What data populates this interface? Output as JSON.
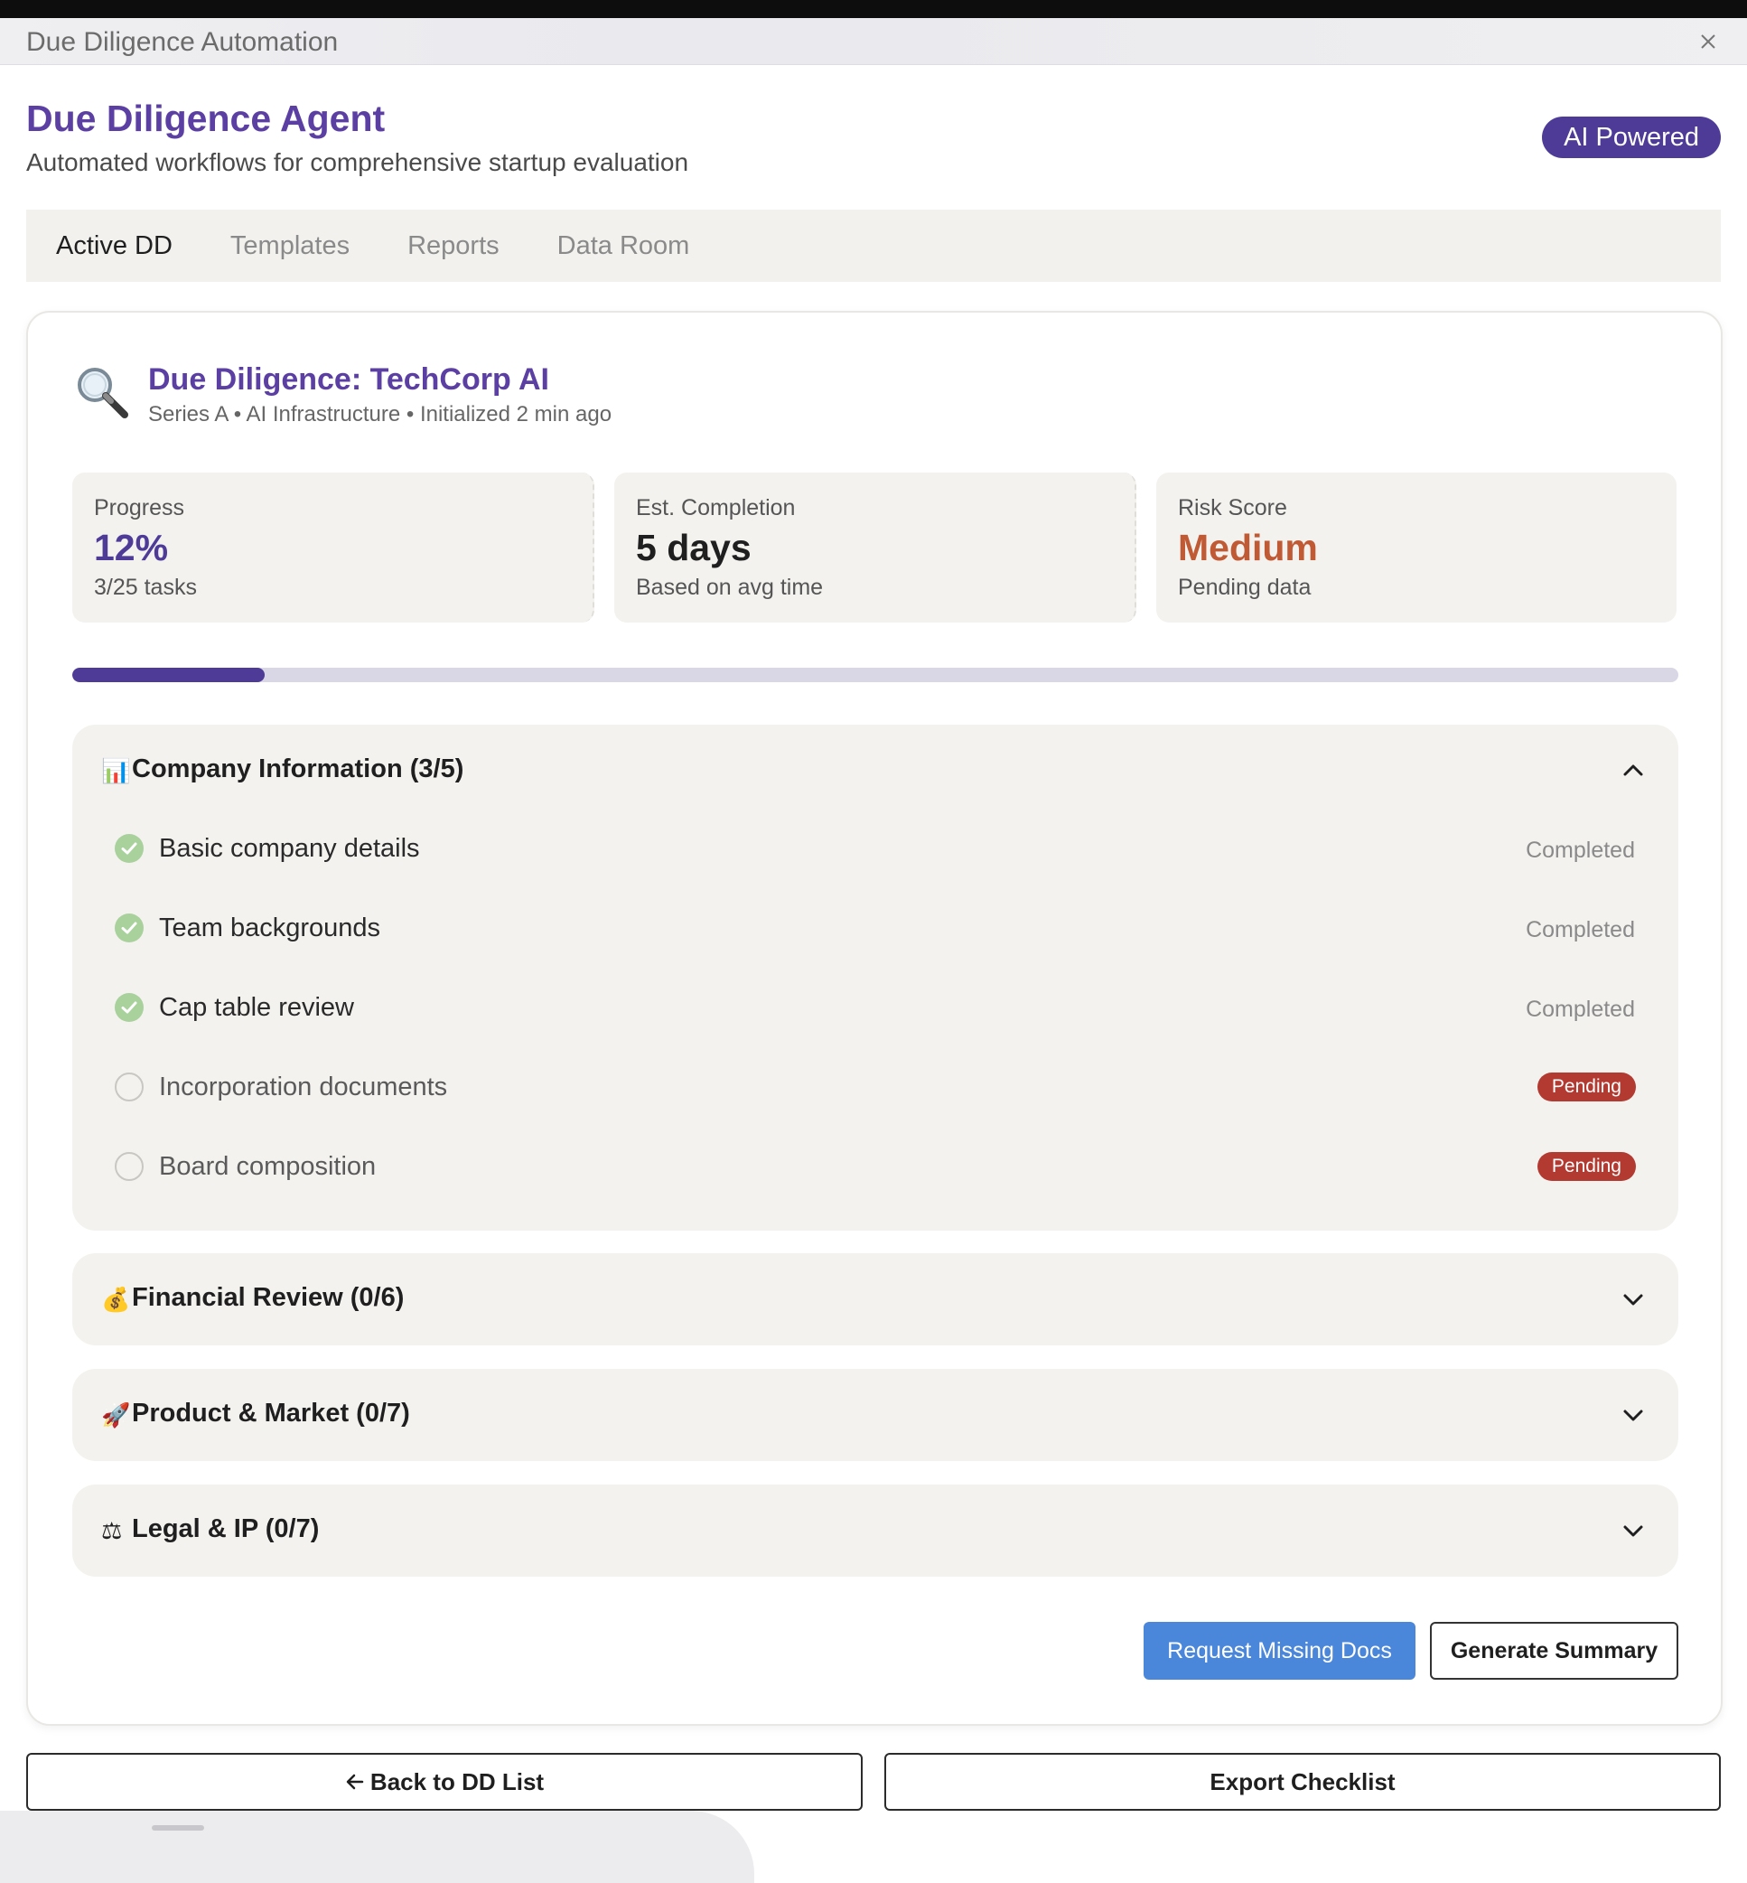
{
  "window": {
    "title": "Due Diligence Automation"
  },
  "header": {
    "title": "Due Diligence Agent",
    "subtitle": "Automated workflows for comprehensive startup evaluation",
    "badge": "AI Powered"
  },
  "tabs": [
    {
      "label": "Active DD",
      "active": true
    },
    {
      "label": "Templates",
      "active": false
    },
    {
      "label": "Reports",
      "active": false
    },
    {
      "label": "Data Room",
      "active": false
    }
  ],
  "dd": {
    "icon": "magnifying-glass-icon",
    "title": "Due Diligence: TechCorp AI",
    "meta": "Series A • AI Infrastructure • Initialized 2 min ago",
    "stats": [
      {
        "label": "Progress",
        "value": "12%",
        "sub": "3/25 tasks",
        "color": "#4e3b98"
      },
      {
        "label": "Est. Completion",
        "value": "5 days",
        "sub": "Based on avg time",
        "color": "#1f1f1f"
      },
      {
        "label": "Risk Score",
        "value": "Medium",
        "sub": "Pending data",
        "color": "#c05a35"
      }
    ],
    "progress_fraction": 0.12
  },
  "sections": [
    {
      "emoji": "📊",
      "icon": "bar-chart-icon",
      "title": "Company Information (3/5)",
      "expanded": true,
      "tasks": [
        {
          "label": "Basic company details",
          "status": "Completed",
          "done": true
        },
        {
          "label": "Team backgrounds",
          "status": "Completed",
          "done": true
        },
        {
          "label": "Cap table review",
          "status": "Completed",
          "done": true
        },
        {
          "label": "Incorporation documents",
          "status": "Pending",
          "done": false
        },
        {
          "label": "Board composition",
          "status": "Pending",
          "done": false
        }
      ]
    },
    {
      "emoji": "💰",
      "icon": "money-bag-icon",
      "title": "Financial Review (0/6)",
      "expanded": false
    },
    {
      "emoji": "🚀",
      "icon": "rocket-icon",
      "title": "Product & Market (0/7)",
      "expanded": false
    },
    {
      "emoji": "⚖",
      "icon": "scales-icon",
      "title": "Legal & IP (0/7)",
      "expanded": false
    }
  ],
  "actions": {
    "request_docs": "Request Missing Docs",
    "generate_summary": "Generate Summary"
  },
  "footer": {
    "back": "Back to DD List",
    "export": "Export Checklist"
  },
  "colors": {
    "accent": "#5b3fa3",
    "badge": "#4e3b98",
    "primary_button": "#4a86d9",
    "pending": "#b33a31",
    "completed_check": "#a8d19c",
    "risk_medium": "#c05a35"
  }
}
